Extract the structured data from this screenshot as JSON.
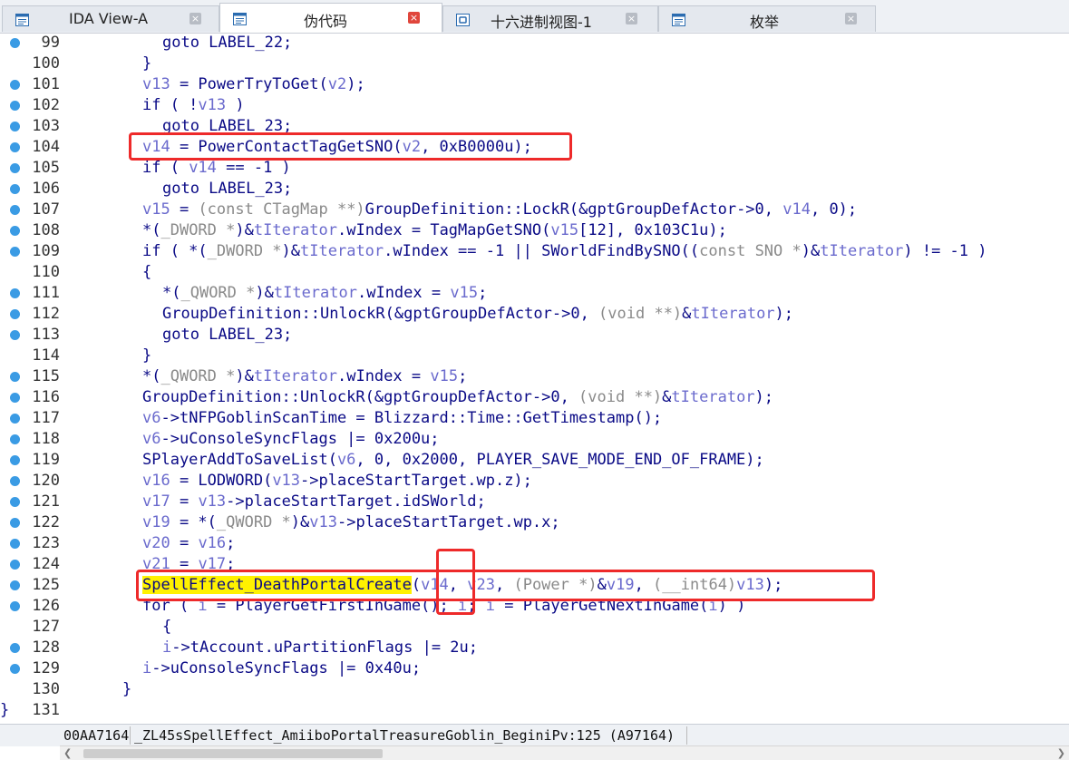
{
  "tabs": [
    {
      "label": "IDA View-A",
      "icon": "disassembly-view-icon",
      "active": false
    },
    {
      "label": "伪代码",
      "icon": "pseudocode-view-icon",
      "active": true
    },
    {
      "label": "十六进制视图-1",
      "icon": "hex-view-icon",
      "active": false
    },
    {
      "label": "枚举",
      "icon": "enums-view-icon",
      "active": false
    }
  ],
  "code_lines": [
    {
      "num": "99",
      "bp": true,
      "tokens": [
        [
          "goto LABEL_22;",
          ""
        ]
      ]
    },
    {
      "num": "100",
      "bp": false,
      "tokens": [
        [
          "}",
          ""
        ]
      ]
    },
    {
      "num": "101",
      "bp": true,
      "tokens": [
        [
          "v13",
          "v"
        ],
        [
          " = PowerTryToGet(",
          ""
        ],
        [
          "v2",
          "v"
        ],
        [
          ");",
          ""
        ]
      ]
    },
    {
      "num": "102",
      "bp": true,
      "tokens": [
        [
          "if ( !",
          ""
        ],
        [
          "v13",
          "v"
        ],
        [
          " )",
          ""
        ]
      ]
    },
    {
      "num": "103",
      "bp": true,
      "tokens": [
        [
          "goto LABEL_23;",
          ""
        ]
      ]
    },
    {
      "num": "104",
      "bp": true,
      "tokens": [
        [
          "v14",
          "v"
        ],
        [
          " = PowerContactTagGetSNO(",
          ""
        ],
        [
          "v2",
          "v"
        ],
        [
          ", 0xB0000u);",
          ""
        ]
      ]
    },
    {
      "num": "105",
      "bp": true,
      "tokens": [
        [
          "if ( ",
          ""
        ],
        [
          "v14",
          "v"
        ],
        [
          " == -1 )",
          ""
        ]
      ]
    },
    {
      "num": "106",
      "bp": true,
      "tokens": [
        [
          "goto LABEL_23;",
          ""
        ]
      ]
    },
    {
      "num": "107",
      "bp": true,
      "tokens": [
        [
          "v15",
          "v"
        ],
        [
          " = ",
          ""
        ],
        [
          "(const CTagMap **)",
          "d"
        ],
        [
          "GroupDefinition::LockR(&gptGroupDefActor->0, ",
          ""
        ],
        [
          "v14",
          "v"
        ],
        [
          ", 0);",
          ""
        ]
      ]
    },
    {
      "num": "108",
      "bp": true,
      "tokens": [
        [
          "*(",
          ""
        ],
        [
          "_DWORD *",
          "d"
        ],
        [
          ")&",
          ""
        ],
        [
          "tIterator",
          "v"
        ],
        [
          ".wIndex = TagMapGetSNO(",
          ""
        ],
        [
          "v15",
          "v"
        ],
        [
          "[12], 0x103C1u);",
          ""
        ]
      ]
    },
    {
      "num": "109",
      "bp": true,
      "tokens": [
        [
          "if ( *(",
          ""
        ],
        [
          "_DWORD *",
          "d"
        ],
        [
          ")&",
          ""
        ],
        [
          "tIterator",
          "v"
        ],
        [
          ".wIndex == -1 || SWorldFindBySNO((",
          ""
        ],
        [
          "const SNO *",
          "d"
        ],
        [
          ")&",
          ""
        ],
        [
          "tIterator",
          "v"
        ],
        [
          ") != -1 )",
          ""
        ]
      ]
    },
    {
      "num": "110",
      "bp": false,
      "tokens": [
        [
          "{",
          ""
        ]
      ]
    },
    {
      "num": "111",
      "bp": true,
      "tokens": [
        [
          "*(",
          ""
        ],
        [
          "_QWORD *",
          "d"
        ],
        [
          ")&",
          ""
        ],
        [
          "tIterator",
          "v"
        ],
        [
          ".wIndex = ",
          ""
        ],
        [
          "v15",
          "v"
        ],
        [
          ";",
          ""
        ]
      ]
    },
    {
      "num": "112",
      "bp": true,
      "tokens": [
        [
          "GroupDefinition::UnlockR(&gptGroupDefActor->0, ",
          ""
        ],
        [
          "(void **)",
          "d"
        ],
        [
          "&",
          ""
        ],
        [
          "tIterator",
          "v"
        ],
        [
          ");",
          ""
        ]
      ]
    },
    {
      "num": "113",
      "bp": true,
      "tokens": [
        [
          "goto LABEL_23;",
          ""
        ]
      ]
    },
    {
      "num": "114",
      "bp": false,
      "tokens": [
        [
          "}",
          ""
        ]
      ]
    },
    {
      "num": "115",
      "bp": true,
      "tokens": [
        [
          "*(",
          ""
        ],
        [
          "_QWORD *",
          "d"
        ],
        [
          ")&",
          ""
        ],
        [
          "tIterator",
          "v"
        ],
        [
          ".wIndex = ",
          ""
        ],
        [
          "v15",
          "v"
        ],
        [
          ";",
          ""
        ]
      ]
    },
    {
      "num": "116",
      "bp": true,
      "tokens": [
        [
          "GroupDefinition::UnlockR(&gptGroupDefActor->0, ",
          ""
        ],
        [
          "(void **)",
          "d"
        ],
        [
          "&",
          ""
        ],
        [
          "tIterator",
          "v"
        ],
        [
          ");",
          ""
        ]
      ]
    },
    {
      "num": "117",
      "bp": true,
      "tokens": [
        [
          "v6",
          "v"
        ],
        [
          "->tNFPGoblinScanTime = Blizzard::Time::GetTimestamp();",
          ""
        ]
      ]
    },
    {
      "num": "118",
      "bp": true,
      "tokens": [
        [
          "v6",
          "v"
        ],
        [
          "->uConsoleSyncFlags |= 0x200u;",
          ""
        ]
      ]
    },
    {
      "num": "119",
      "bp": true,
      "tokens": [
        [
          "SPlayerAddToSaveList(",
          ""
        ],
        [
          "v6",
          "v"
        ],
        [
          ", 0, 0x2000, PLAYER_SAVE_MODE_END_OF_FRAME);",
          ""
        ]
      ]
    },
    {
      "num": "120",
      "bp": true,
      "tokens": [
        [
          "v16",
          "v"
        ],
        [
          " = LODWORD(",
          ""
        ],
        [
          "v13",
          "v"
        ],
        [
          "->placeStartTarget.wp.z);",
          ""
        ]
      ]
    },
    {
      "num": "121",
      "bp": true,
      "tokens": [
        [
          "v17",
          "v"
        ],
        [
          " = ",
          ""
        ],
        [
          "v13",
          "v"
        ],
        [
          "->placeStartTarget.idSWorld;",
          ""
        ]
      ]
    },
    {
      "num": "122",
      "bp": true,
      "tokens": [
        [
          "v19",
          "v"
        ],
        [
          " = *(",
          ""
        ],
        [
          "_QWORD *",
          "d"
        ],
        [
          ")&",
          ""
        ],
        [
          "v13",
          "v"
        ],
        [
          "->placeStartTarget.wp.x;",
          ""
        ]
      ]
    },
    {
      "num": "123",
      "bp": true,
      "tokens": [
        [
          "v20",
          "v"
        ],
        [
          " = ",
          ""
        ],
        [
          "v16",
          "v"
        ],
        [
          ";",
          ""
        ]
      ]
    },
    {
      "num": "124",
      "bp": true,
      "tokens": [
        [
          "v21",
          "v"
        ],
        [
          " = ",
          ""
        ],
        [
          "v17",
          "v"
        ],
        [
          ";",
          ""
        ]
      ]
    },
    {
      "num": "125",
      "bp": true,
      "tokens": [
        [
          "SpellEffect_DeathPortalCreate",
          "hl"
        ],
        [
          "(",
          ""
        ],
        [
          "v14",
          "v"
        ],
        [
          ", ",
          ""
        ],
        [
          "v23",
          "v"
        ],
        [
          ", ",
          ""
        ],
        [
          "(Power *)",
          "d"
        ],
        [
          "&",
          ""
        ],
        [
          "v19",
          "v"
        ],
        [
          ", ",
          ""
        ],
        [
          "(__int64)",
          "d"
        ],
        [
          "v13",
          "v"
        ],
        [
          ");",
          ""
        ]
      ]
    },
    {
      "num": "126",
      "bp": true,
      "tokens": [
        [
          "for ( ",
          ""
        ],
        [
          "i",
          "v"
        ],
        [
          " = PlayerGetFirstInGame(); ",
          ""
        ],
        [
          "i",
          "v"
        ],
        [
          "; ",
          ""
        ],
        [
          "i",
          "v"
        ],
        [
          " = PlayerGetNextInGame(",
          ""
        ],
        [
          "i",
          "v"
        ],
        [
          ") )",
          ""
        ]
      ]
    },
    {
      "num": "127",
      "bp": false,
      "tokens": [
        [
          "{",
          ""
        ]
      ]
    },
    {
      "num": "128",
      "bp": true,
      "tokens": [
        [
          "i",
          "v"
        ],
        [
          "->tAccount.uPartitionFlags |= 2u;",
          ""
        ]
      ]
    },
    {
      "num": "129",
      "bp": true,
      "tokens": [
        [
          "i",
          "v"
        ],
        [
          "->uConsoleSyncFlags |= 0x40u;",
          ""
        ]
      ]
    },
    {
      "num": "130",
      "bp": false,
      "tokens": [
        [
          "}",
          ""
        ]
      ]
    },
    {
      "num": "131",
      "bp": false,
      "tokens": [
        [
          "}",
          ""
        ]
      ]
    }
  ],
  "status": {
    "address": "00AA7164",
    "location": "_ZL45sSpellEffect_AmiiboPortalTreasureGoblin_BeginiPv:125 (A97164)"
  },
  "colors": {
    "text": "#0a0a86",
    "variable": "#6a6acd",
    "type_cast": "#8a8a8a",
    "highlight": "#fff200",
    "annotation_box": "#ee2a2a",
    "breakpoint_dot": "#3a9be4"
  }
}
